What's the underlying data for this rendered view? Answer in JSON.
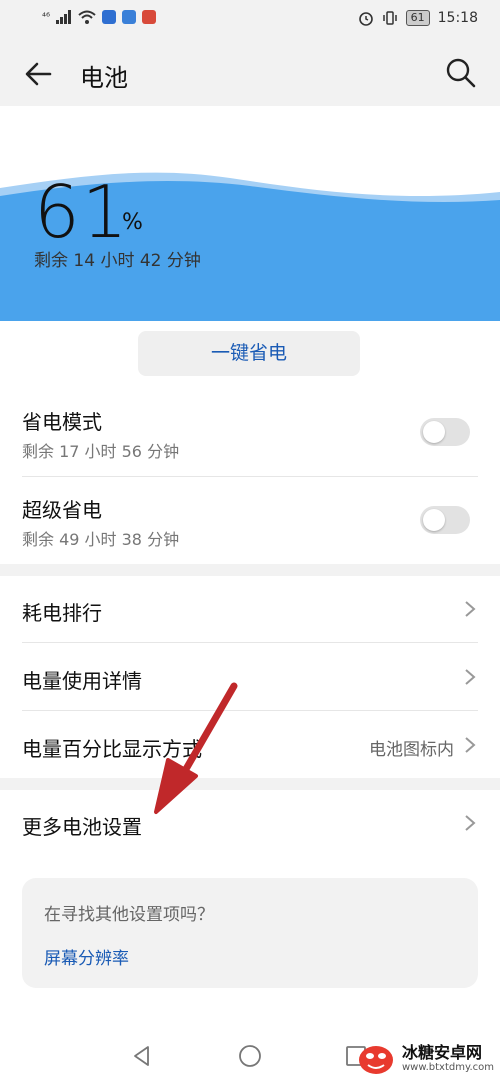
{
  "status_bar": {
    "network": "⁴⁶",
    "time": "15:18",
    "battery_level": "61"
  },
  "app_bar": {
    "title": "电池"
  },
  "battery": {
    "percent": "61",
    "percent_sign": "%",
    "remaining": "剩余 14 小时 42 分钟",
    "fill_fraction": 0.61,
    "wave_color": "#4aa3ec"
  },
  "one_tap_saver": {
    "label": "一键省电"
  },
  "modes": [
    {
      "title": "省电模式",
      "subtitle": "剩余 17 小时 56 分钟",
      "enabled": false
    },
    {
      "title": "超级省电",
      "subtitle": "剩余 49 小时 38 分钟",
      "enabled": false
    }
  ],
  "menu": [
    {
      "title": "耗电排行"
    },
    {
      "title": "电量使用详情"
    },
    {
      "title": "电量百分比显示方式",
      "value": "电池图标内"
    }
  ],
  "more": {
    "title": "更多电池设置"
  },
  "card": {
    "question": "在寻找其他设置项吗？",
    "link": "屏幕分辨率"
  },
  "watermark": {
    "name": "冰糖安卓网",
    "url": "www.btxtdmy.com"
  },
  "colors": {
    "accent": "#1a5bb5",
    "arrow": "#c0282a"
  }
}
